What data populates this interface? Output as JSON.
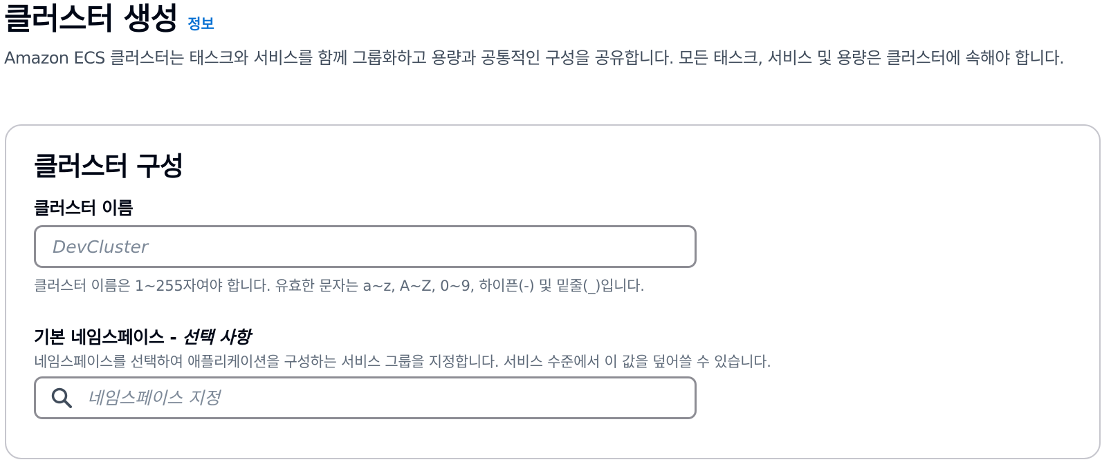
{
  "header": {
    "title": "클러스터 생성",
    "info_link": "정보",
    "description": "Amazon ECS 클러스터는 태스크와 서비스를 함께 그룹화하고 용량과 공통적인 구성을 공유합니다. 모든 태스크, 서비스 및 용량은 클러스터에 속해야 합니다."
  },
  "cluster_configuration": {
    "title": "클러스터 구성",
    "cluster_name": {
      "label": "클러스터 이름",
      "value": "",
      "placeholder": "DevCluster",
      "constraint": "클러스터 이름은 1~255자여야 합니다. 유효한 문자는 a~z, A~Z, 0~9, 하이픈(-) 및 밑줄(_)입니다."
    },
    "default_namespace": {
      "label": "기본 네임스페이스",
      "label_separator": " - ",
      "optional_label": "선택 사항",
      "description": "네임스페이스를 선택하여 애플리케이션을 구성하는 서비스 그룹을 지정합니다. 서비스 수준에서 이 값을 덮어쓸 수 있습니다.",
      "value": "",
      "placeholder": "네임스페이스 지정",
      "icon": "search-icon"
    }
  },
  "colors": {
    "text": "#000716",
    "secondary_text": "#414d5c",
    "link": "#0972d3",
    "border": "#8d8d94",
    "container_border": "#c6c6cd"
  }
}
